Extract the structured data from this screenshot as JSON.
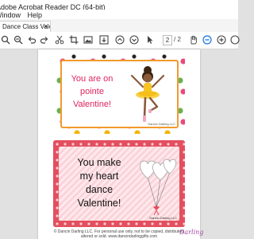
{
  "window": {
    "title": "Adobe Acrobat Reader DC (64-bit)"
  },
  "menu": {
    "items": [
      "Window",
      "Help"
    ]
  },
  "tab": {
    "label": "Dance Class Valenti...",
    "close": "×"
  },
  "toolbar": {
    "current_page": "2",
    "total_pages": "/ 2",
    "icons": [
      "search-icon",
      "zoom-out-icon",
      "undo-icon",
      "redo-icon",
      "cut-icon",
      "crop-icon",
      "image-icon",
      "download-icon",
      "up-icon",
      "down-icon",
      "hand-icon",
      "zoom-out-circle-icon",
      "zoom-in-circle-icon"
    ]
  },
  "card1": {
    "lines": [
      "You are on",
      "pointe",
      "Valentine!"
    ],
    "credit": "Dancin Darling LLC"
  },
  "card2": {
    "lines": [
      "You make",
      "my heart",
      "dance",
      "Valentine!"
    ],
    "credit": "Dancin Darling LLC"
  },
  "footer": {
    "line1": "© Dancin Darling LLC. For personal use only, not to be copied, distributed,",
    "line2": "altered or sold.  www.dancindarlinggifts.com",
    "logo": "Darling"
  },
  "colors": {
    "card1_border": "#f29a2e",
    "card1_text": "#e0245e",
    "card2_frame": "#e34f5f",
    "card2_background": "#ffe9ec"
  }
}
